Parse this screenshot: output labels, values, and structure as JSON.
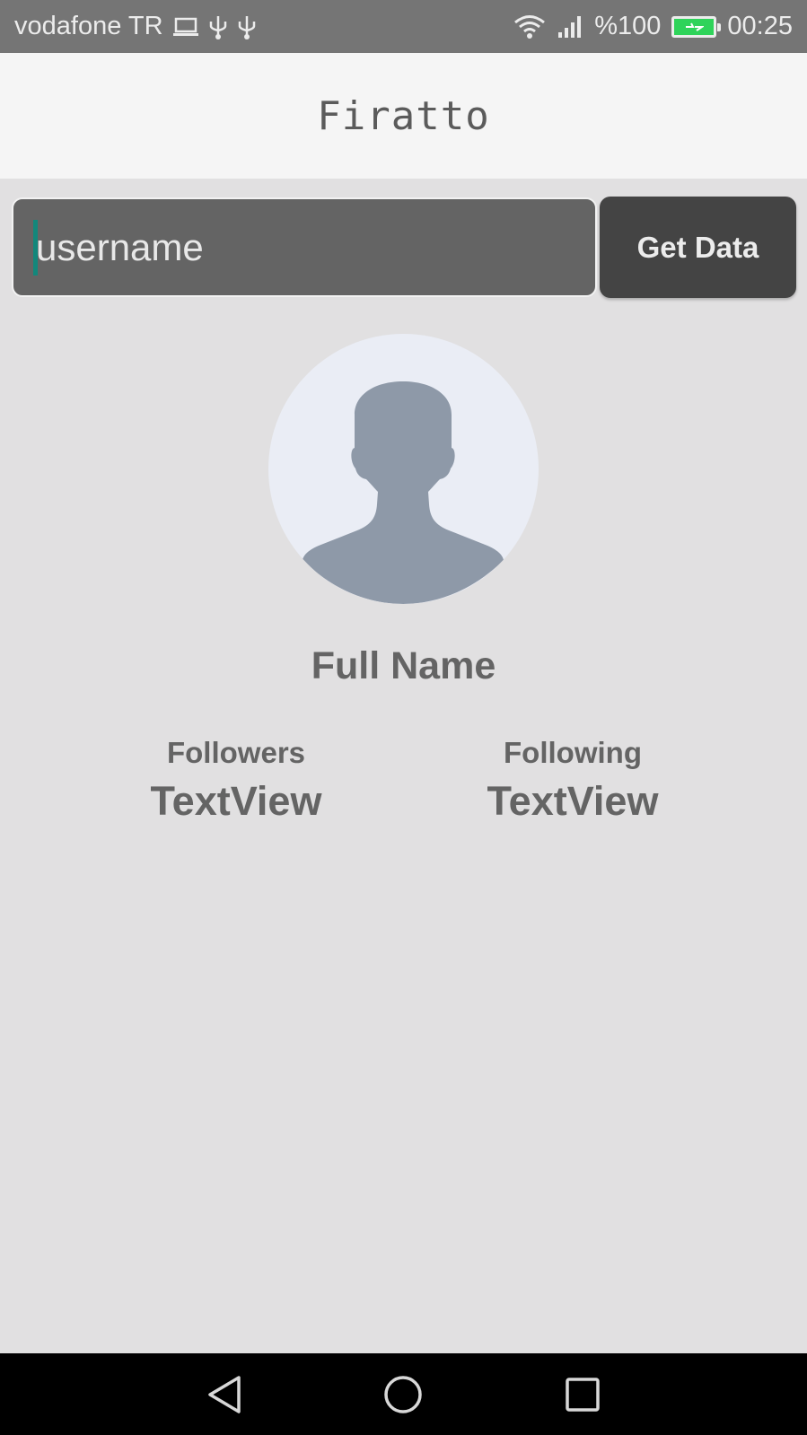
{
  "status_bar": {
    "carrier": "vodafone TR",
    "battery_percent": "%100",
    "time": "00:25",
    "icons": [
      "laptop-icon",
      "usb-icon",
      "usb-icon",
      "wifi-icon",
      "signal-icon",
      "battery-charging-icon"
    ]
  },
  "app": {
    "title": "Firatto"
  },
  "search": {
    "placeholder": "username",
    "button_label": "Get Data"
  },
  "profile": {
    "full_name": "Full Name",
    "followers_label": "Followers",
    "followers_value": "TextView",
    "following_label": "Following",
    "following_value": "TextView"
  },
  "nav_bar": {
    "buttons": [
      "back-icon",
      "home-icon",
      "recents-icon"
    ]
  },
  "colors": {
    "background": "#e1e0e1",
    "status_bar": "#757575",
    "app_bar": "#f5f5f5",
    "input_bg": "#646464",
    "button_bg": "#444444",
    "cursor": "#12877b",
    "avatar_bg": "#eaedf5",
    "avatar_silhouette": "#8e99a8",
    "text": "#646464"
  }
}
